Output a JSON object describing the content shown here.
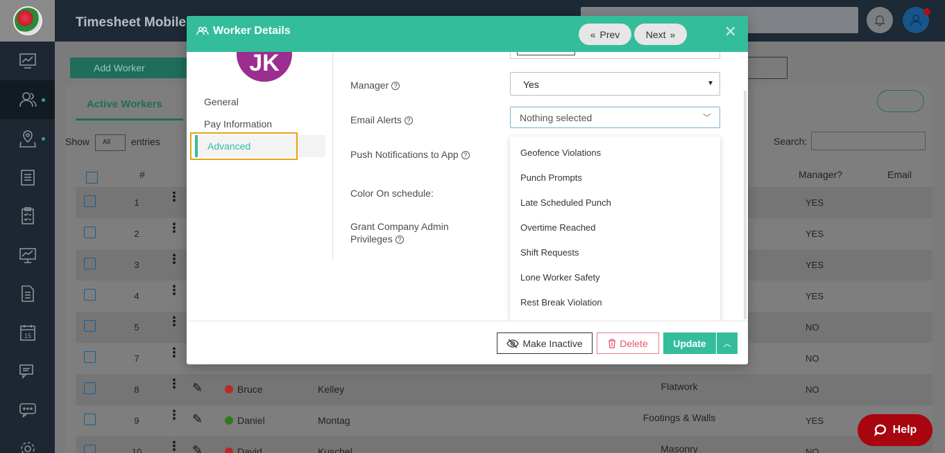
{
  "header": {
    "app_title": "Timesheet Mobile"
  },
  "background": {
    "add_worker": "Add Worker",
    "tab": "Active Workers",
    "show": "Show",
    "entries_select": "All",
    "entries": "entries",
    "search_label": "Search:",
    "columns": {
      "hash": "#",
      "manager": "Manager?",
      "email": "Email"
    },
    "rows": [
      {
        "num": "1",
        "first": "",
        "last": "",
        "job": "",
        "manager": "YES",
        "status": ""
      },
      {
        "num": "2",
        "first": "",
        "last": "",
        "job": "",
        "manager": "YES",
        "status": ""
      },
      {
        "num": "3",
        "first": "",
        "last": "",
        "job": "",
        "manager": "YES",
        "status": ""
      },
      {
        "num": "4",
        "first": "",
        "last": "",
        "job": "",
        "manager": "YES",
        "status": ""
      },
      {
        "num": "5",
        "first": "",
        "last": "",
        "job": "",
        "manager": "NO",
        "status": ""
      },
      {
        "num": "7",
        "first": "",
        "last": "",
        "job": "",
        "manager": "NO",
        "status": ""
      },
      {
        "num": "8",
        "first": "Bruce",
        "last": "Kelley",
        "job": "Flatwork",
        "manager": "NO",
        "status": "#b8292a"
      },
      {
        "num": "9",
        "first": "Daniel",
        "last": "Montag",
        "job": "Footings & Walls",
        "manager": "YES",
        "status": "#2f7a1f"
      },
      {
        "num": "10",
        "first": "David",
        "last": "Kuschel",
        "job": "Masonry",
        "manager": "NO",
        "status": "#b8292a"
      }
    ],
    "help": "Help"
  },
  "modal": {
    "title": "Worker Details",
    "prev": "Prev",
    "next": "Next",
    "avatar_initials": "JK",
    "left_nav": [
      "General",
      "Pay Information",
      "Advanced"
    ],
    "labels": {
      "manager": "Manager",
      "email_alerts": "Email Alerts",
      "push": "Push Notifications to App",
      "color": "Color On schedule:",
      "grant": "Grant Company Admin Privileges"
    },
    "manager_value": "Yes",
    "email_alerts_placeholder": "Nothing selected",
    "alert_options": [
      "Geofence Violations",
      "Punch Prompts",
      "Late Scheduled Punch",
      "Overtime Reached",
      "Shift Requests",
      "Lone Worker Safety",
      "Rest Break Violation"
    ],
    "buttons": {
      "inactive": "Make Inactive",
      "delete": "Delete",
      "update": "Update"
    }
  },
  "colors": {
    "accent": "#34bd9b",
    "sidebar": "#1c2731",
    "avatar": "#9b2e8e",
    "highlight": "#e8a219",
    "help": "#a8050e"
  }
}
